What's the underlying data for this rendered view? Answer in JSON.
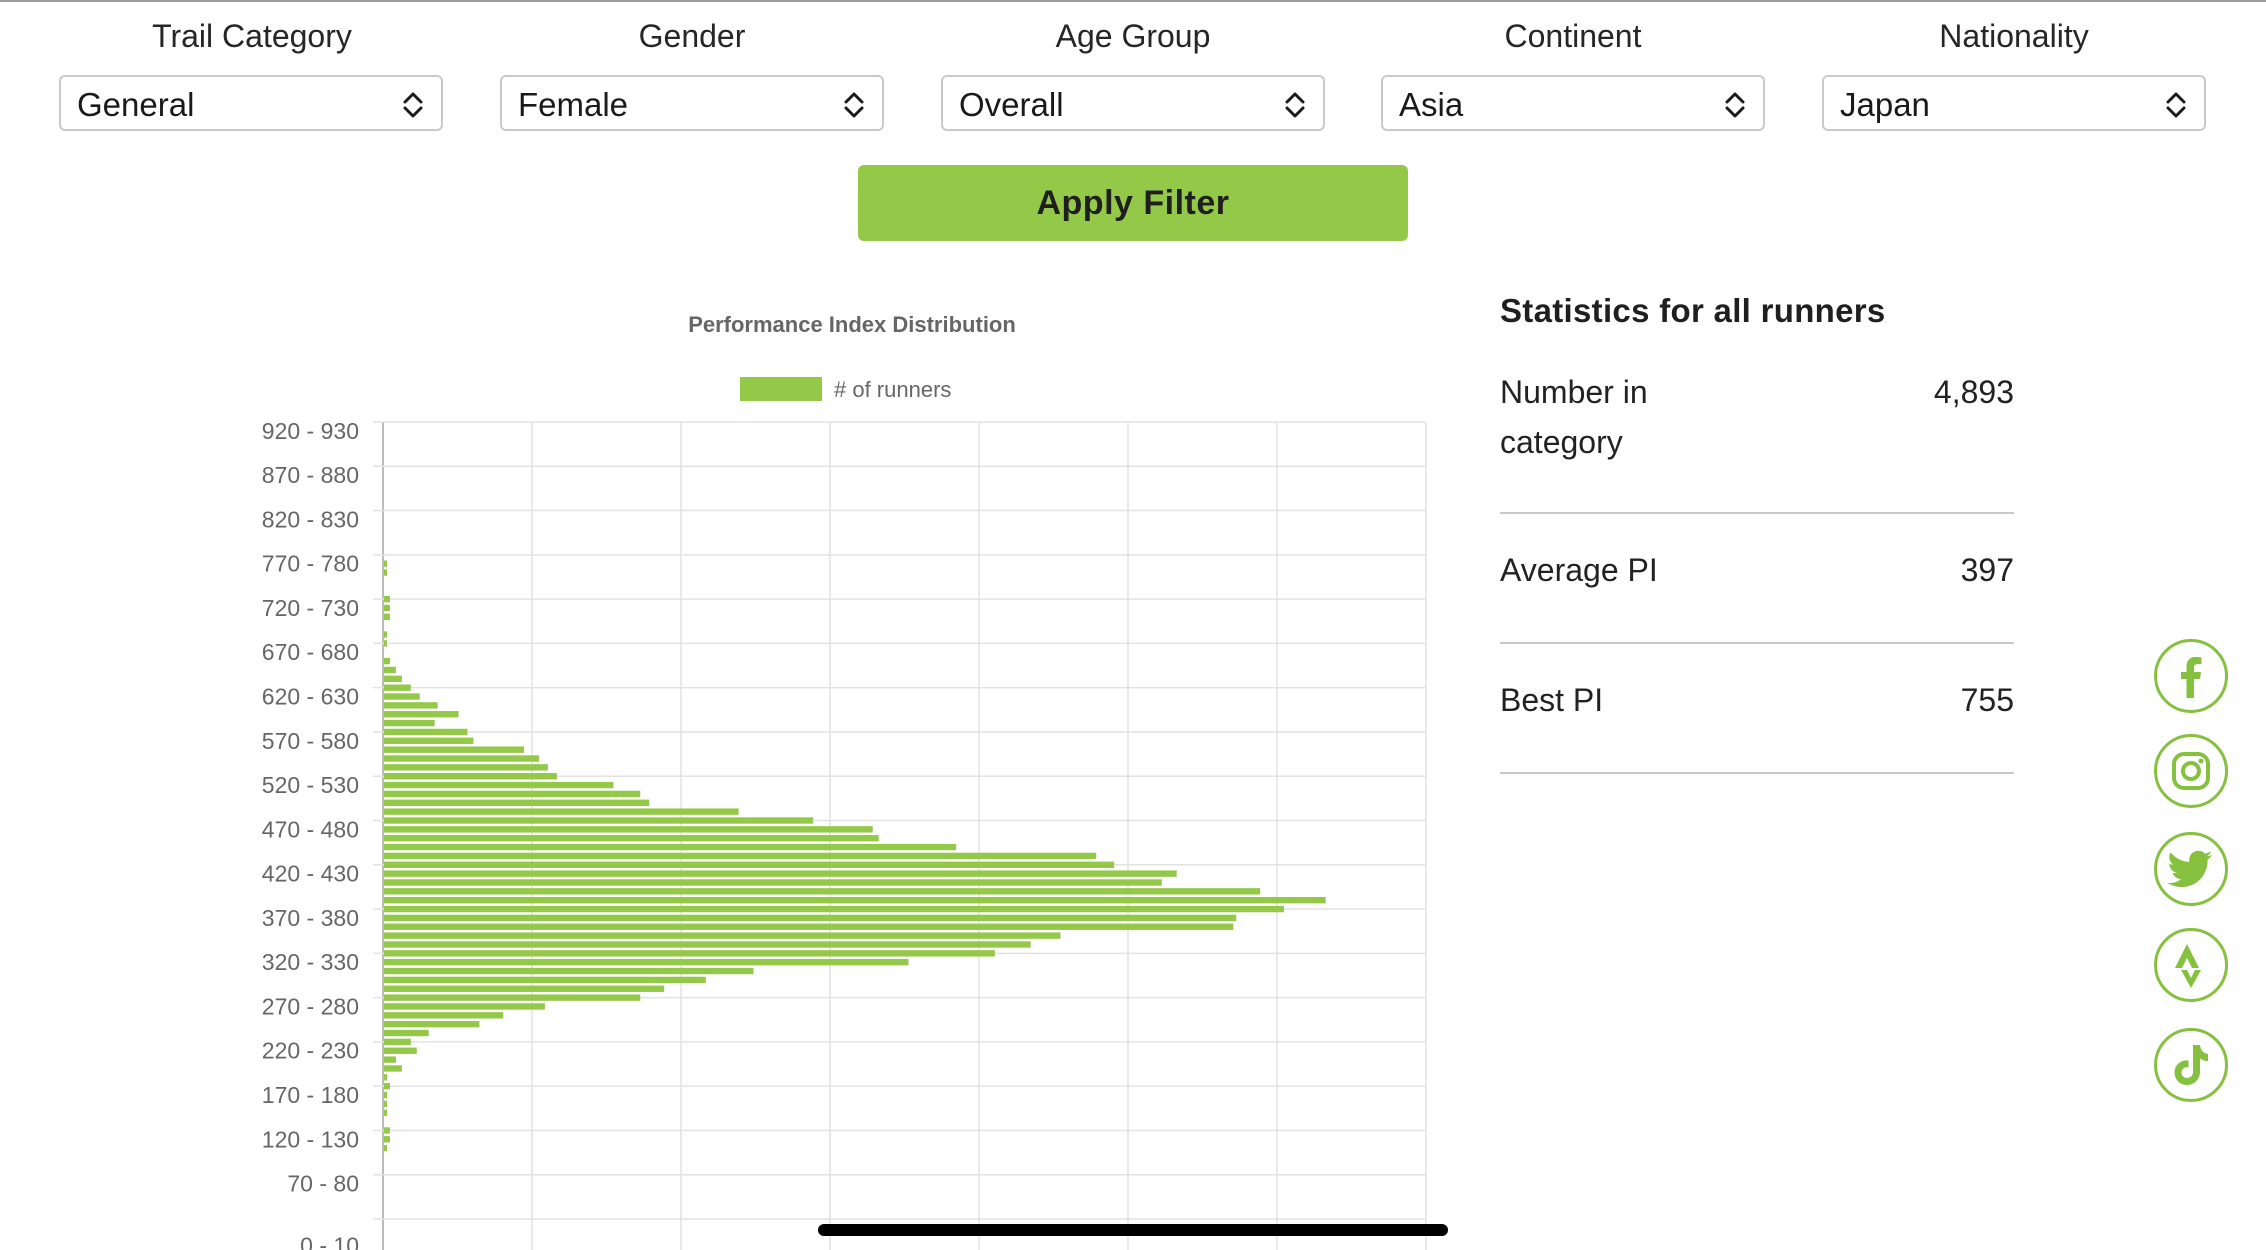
{
  "filters": [
    {
      "label": "Trail Category",
      "value": "General"
    },
    {
      "label": "Gender",
      "value": "Female"
    },
    {
      "label": "Age Group",
      "value": "Overall"
    },
    {
      "label": "Continent",
      "value": "Asia"
    },
    {
      "label": "Nationality",
      "value": "Japan"
    }
  ],
  "apply_button_label": "Apply Filter",
  "chart_data": {
    "type": "bar",
    "orientation": "horizontal",
    "title": "Performance Index Distribution",
    "legend": {
      "label": "# of runners",
      "placement": "top"
    },
    "color": "#94c848",
    "grid": true,
    "xlim": [
      0,
      350
    ],
    "y_tick_labels": [
      "920 - 930",
      "870 - 880",
      "820 - 830",
      "770 - 780",
      "720 - 730",
      "670 - 680",
      "620 - 630",
      "570 - 580",
      "520 - 530",
      "470 - 480",
      "420 - 430",
      "370 - 380",
      "320 - 330",
      "270 - 280",
      "220 - 230",
      "170 - 180",
      "120 - 130",
      "70 - 80",
      "0 - 10"
    ],
    "series": [
      {
        "name": "# of runners",
        "bins": [
          [
            770,
            1
          ],
          [
            760,
            1
          ],
          [
            750,
            0
          ],
          [
            740,
            0
          ],
          [
            730,
            2
          ],
          [
            720,
            2
          ],
          [
            710,
            2
          ],
          [
            700,
            0
          ],
          [
            690,
            1
          ],
          [
            680,
            1
          ],
          [
            670,
            0
          ],
          [
            660,
            2
          ],
          [
            650,
            4
          ],
          [
            640,
            6
          ],
          [
            630,
            9
          ],
          [
            620,
            12
          ],
          [
            610,
            18
          ],
          [
            600,
            25
          ],
          [
            590,
            17
          ],
          [
            580,
            28
          ],
          [
            570,
            30
          ],
          [
            560,
            47
          ],
          [
            550,
            52
          ],
          [
            540,
            55
          ],
          [
            530,
            58
          ],
          [
            520,
            77
          ],
          [
            510,
            86
          ],
          [
            500,
            89
          ],
          [
            490,
            119
          ],
          [
            480,
            144
          ],
          [
            470,
            164
          ],
          [
            460,
            166
          ],
          [
            450,
            192
          ],
          [
            440,
            239
          ],
          [
            430,
            245
          ],
          [
            420,
            266
          ],
          [
            410,
            261
          ],
          [
            400,
            294
          ],
          [
            390,
            316
          ],
          [
            380,
            302
          ],
          [
            370,
            286
          ],
          [
            360,
            285
          ],
          [
            350,
            227
          ],
          [
            340,
            217
          ],
          [
            330,
            205
          ],
          [
            320,
            176
          ],
          [
            310,
            124
          ],
          [
            300,
            108
          ],
          [
            290,
            94
          ],
          [
            280,
            86
          ],
          [
            270,
            54
          ],
          [
            260,
            40
          ],
          [
            250,
            32
          ],
          [
            240,
            15
          ],
          [
            230,
            9
          ],
          [
            220,
            11
          ],
          [
            210,
            4
          ],
          [
            200,
            6
          ],
          [
            190,
            1
          ],
          [
            180,
            2
          ],
          [
            170,
            1
          ],
          [
            160,
            1
          ],
          [
            150,
            1
          ],
          [
            140,
            0
          ],
          [
            130,
            2
          ],
          [
            120,
            2
          ],
          [
            110,
            1
          ]
        ]
      }
    ]
  },
  "stats": {
    "title": "Statistics for all runners",
    "rows": [
      {
        "label_line1": "Number in",
        "label_line2": "category",
        "value": "4,893"
      },
      {
        "label": "Average PI",
        "value": "397"
      },
      {
        "label": "Best PI",
        "value": "755"
      }
    ]
  },
  "social": [
    "facebook-icon",
    "instagram-icon",
    "twitter-icon",
    "strava-icon",
    "tiktok-icon"
  ],
  "accent_color": "#94c848"
}
